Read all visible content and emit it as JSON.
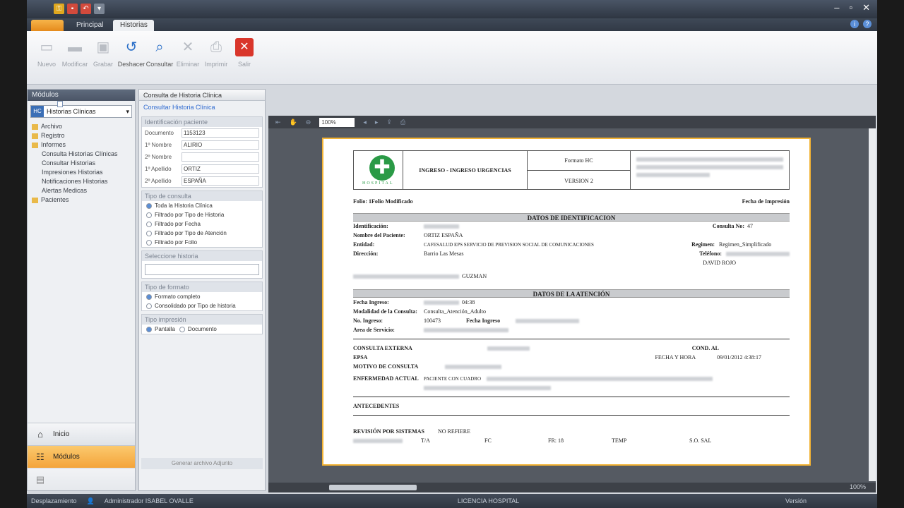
{
  "ribbon": {
    "tabs": [
      "Principal",
      "Historias"
    ],
    "buttons": [
      "Nuevo",
      "Modificar",
      "Grabar",
      "Deshacer",
      "Consultar",
      "Eliminar",
      "Imprimir",
      "Salir"
    ]
  },
  "nav": {
    "header": "Módulos",
    "module_select": "Historias Clínicas",
    "hc_badge": "HC",
    "tree": [
      "Archivo",
      "Registro",
      "Informes",
      "Consulta Historias Clínicas",
      "Consultar Historias",
      "Impresiones Historias",
      "Notificaciones Historias",
      "Alertas Medicas",
      "Pacientes"
    ],
    "bottom": [
      "Inicio",
      "Módulos"
    ]
  },
  "filter": {
    "tab": "Consulta de Historia Clínica",
    "link": "Consultar Historia Clínica",
    "id_section": "Identificación paciente",
    "fields": [
      {
        "label": "Documento",
        "value": "1153123"
      },
      {
        "label": "1º Nombre",
        "value": "ALIRIO"
      },
      {
        "label": "2º Nombre",
        "value": ""
      },
      {
        "label": "1º Apellido",
        "value": "ORTIZ"
      },
      {
        "label": "2º Apellido",
        "value": "ESPAÑA"
      }
    ],
    "type_section": "Tipo de consulta",
    "type_options": [
      "Toda la Historia Clínica",
      "Filtrado por Tipo de Historia",
      "Filtrado por Fecha",
      "Filtrado por Tipo de Atención",
      "Filtrado por Folio"
    ],
    "select_section": "Seleccione historia",
    "format_section": "Tipo de formato",
    "format_options": [
      "Formato completo",
      "Consolidado por Tipo de historia"
    ],
    "print_section": "Tipo impresión",
    "print_options": [
      "Pantalla",
      "Documento"
    ],
    "bottom_btn": "Generar archivo Adjunto"
  },
  "viewer": {
    "zoom_value": "100%",
    "zoom_status": "100%"
  },
  "document": {
    "area": "INGRESO - INGRESO URGENCIAS",
    "code": "Formato HC",
    "version": "VERSION 2",
    "folio_label": "Folio: 1",
    "folio_modified": "Folio Modificado",
    "print_date": "Fecha de Impresión",
    "section1": "DATOS DE IDENTIFICACION",
    "id_label": "Identificación:",
    "cama_label": "Consulta No:",
    "cama_value": "47",
    "name_label": "Nombre del Paciente:",
    "name_value": "ORTIZ ESPAÑA",
    "entidad_label": "Entidad:",
    "entidad_value": "CAFESALUD EPS SERVICIO DE PREVISION SOCIAL DE COMUNICACIONES",
    "regimen_label": "Regimen:",
    "regimen_value": "Regimen_Simplificado",
    "direccion_label": "Dirección:",
    "direccion_value": "Barrio Las Mesas",
    "telefono_label": "Teléfono:",
    "medico_value": "DAVID ROJO",
    "acompanante_value": "GUZMAN",
    "section2": "DATOS DE LA ATENCIÓN",
    "fecha_label": "Fecha Ingreso:",
    "fecha_value": "04:38",
    "modalidad_label": "Modalidad de la Consulta:",
    "modalidad_value": "Consulta_Atención_Adulto",
    "ingreso_label": "No. Ingreso:",
    "ingreso_value": "100473",
    "fecha_ingreso_label": "Fecha Ingreso",
    "area_label": "Area de Servicio:",
    "consulta_label": "CONSULTA EXTERNA",
    "cond_label": "COND. AL",
    "fecha_hora_label": "FECHA Y HORA",
    "fecha_hora_value": "09/01/2012 4:38:17",
    "epsa_label": "EPSA",
    "motivo_label": "MOTIVO DE CONSULTA",
    "enfermedad_label": "ENFERMEDAD ACTUAL",
    "enfermedad_value": "PACIENTE CON CUADRO",
    "antecedentes_label": "ANTECEDENTES",
    "revision_label": "REVISIÓN POR SISTEMAS",
    "revision_value": "NO REFIERE",
    "signos": [
      "T/A",
      "FC",
      "FR: 18",
      "TEMP",
      "S.O. SAL"
    ]
  },
  "statusbar": {
    "left": "Desplazamiento",
    "user": "Administrador ISABEL OVALLE",
    "center": "LICENCIA HOSPITAL",
    "right": "Versión"
  },
  "colors": {
    "accent_orange": "#f4a43a",
    "page_border": "#f2b233",
    "logo_green": "#2a9a46"
  }
}
